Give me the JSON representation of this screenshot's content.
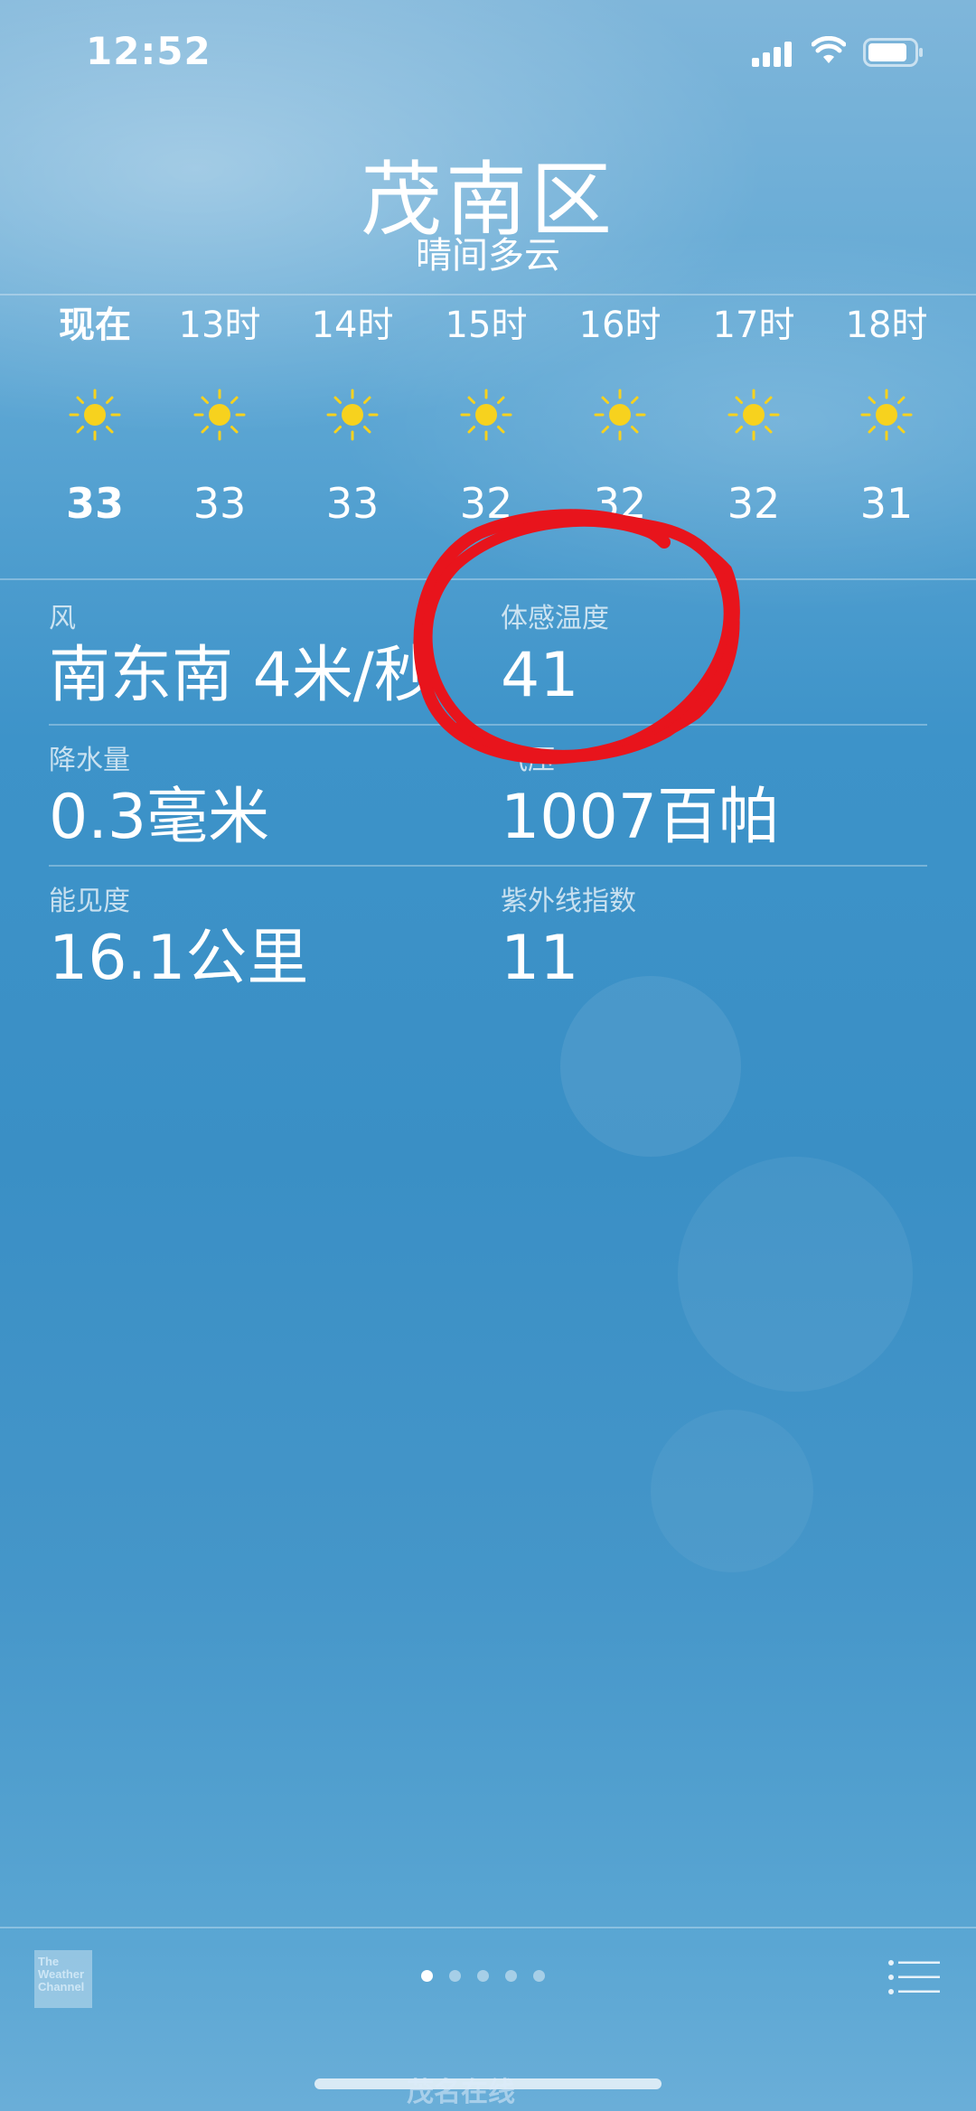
{
  "status_bar": {
    "time": "12:52"
  },
  "location": {
    "city": "茂南区",
    "condition": "晴间多云"
  },
  "hourly": [
    {
      "label": "现在",
      "icon": "sun-icon",
      "temp": "33"
    },
    {
      "label": "13时",
      "icon": "sun-icon",
      "temp": "33"
    },
    {
      "label": "14时",
      "icon": "sun-icon",
      "temp": "33"
    },
    {
      "label": "15时",
      "icon": "sun-icon",
      "temp": "32"
    },
    {
      "label": "16时",
      "icon": "sun-icon",
      "temp": "32"
    },
    {
      "label": "17时",
      "icon": "sun-icon",
      "temp": "32"
    },
    {
      "label": "18时",
      "icon": "sun-icon",
      "temp": "31"
    }
  ],
  "details": {
    "wind": {
      "label": "风",
      "value": "南东南 4米/秒"
    },
    "feels_like": {
      "label": "体感温度",
      "value": "41"
    },
    "precipitation": {
      "label": "降水量",
      "value": "0.3毫米"
    },
    "pressure": {
      "label": "气压",
      "value": "1007百帕"
    },
    "visibility": {
      "label": "能见度",
      "value": "16.1公里"
    },
    "uv_index": {
      "label": "紫外线指数",
      "value": "11"
    }
  },
  "footer": {
    "provider_logo_text": "The Weather Channel",
    "page_count": 5,
    "active_page": 1,
    "watermark": "茂名在线"
  },
  "colors": {
    "sun": "#f7d21e",
    "annotation": "#e8141c"
  }
}
